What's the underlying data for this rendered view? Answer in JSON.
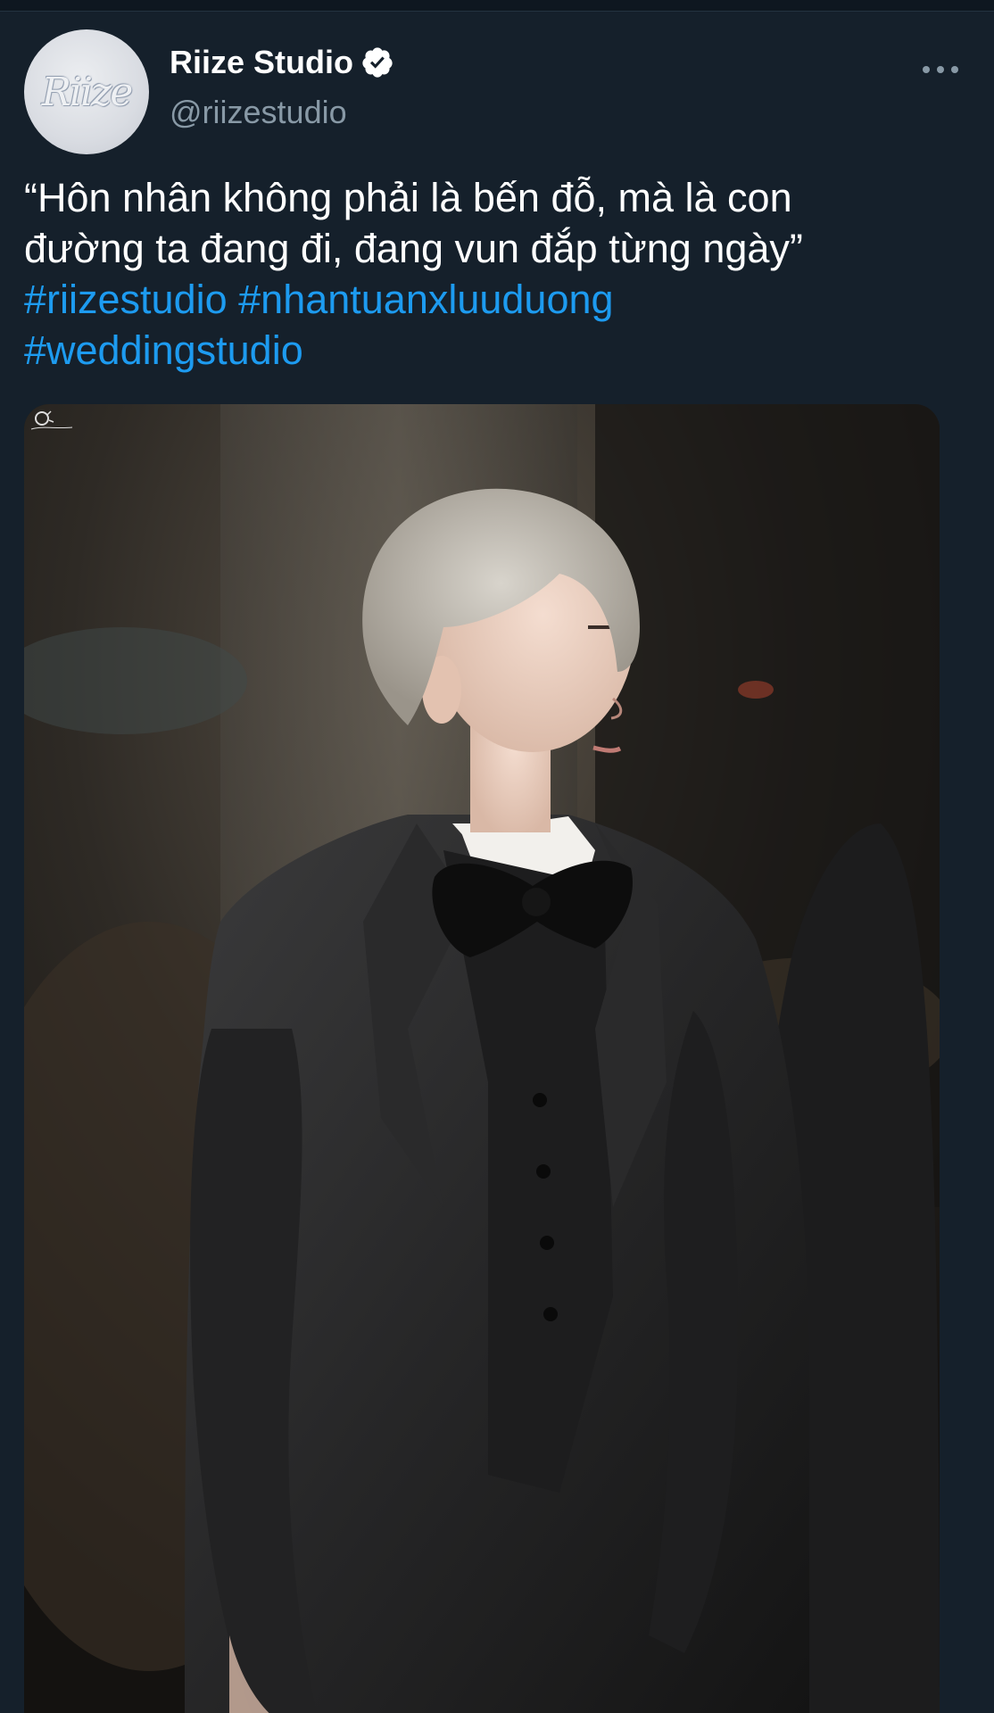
{
  "tweet": {
    "display_name": "Riize Studio",
    "handle": "@riizestudio",
    "avatar_text": "Riize",
    "verified": true,
    "text_lines": [
      "“Hôn nhân không phải là bến đỗ, mà là con",
      "đường ta đang đi, đang vun đắp từng ngày”"
    ],
    "hashtags": [
      "#riizestudio",
      "#nhantuanxluuduong",
      "#weddingstudio"
    ],
    "media": {
      "description_icon": "photo",
      "watermark_icon": "signature-logo-icon"
    }
  },
  "colors": {
    "background": "#15202b",
    "text": "#ffffff",
    "secondary_text": "#8899a6",
    "link": "#1d9bf0"
  }
}
